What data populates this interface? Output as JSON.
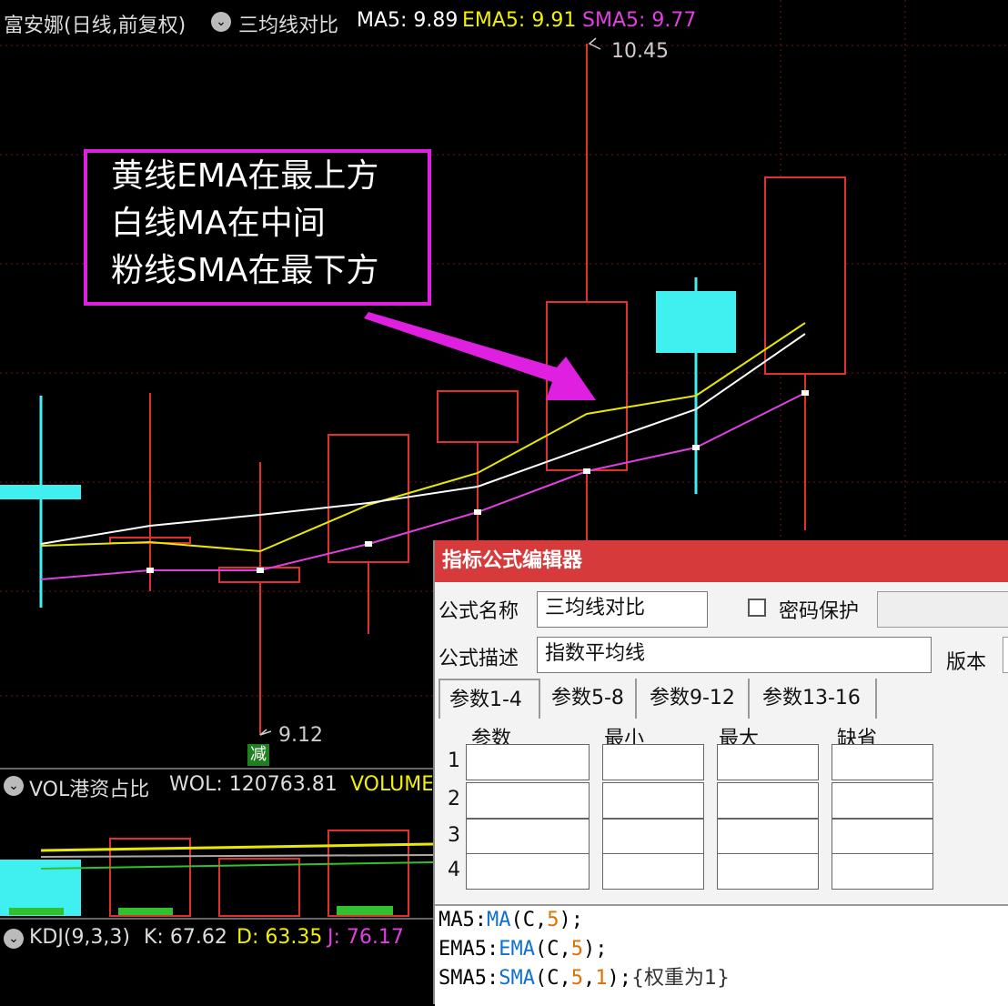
{
  "header": {
    "stock": "富安娜(日线,前复权)",
    "indicator": "三均线对比",
    "ma5": "MA5: 9.89",
    "ema5": "EMA5: 9.91",
    "sma5": "SMA5: 9.77",
    "colors": {
      "ma": "#ffffff",
      "ema": "#f0f000",
      "sma": "#e040e0"
    }
  },
  "price_labels": {
    "high": "10.45",
    "low": "9.12",
    "reduce_badge": "减"
  },
  "callout": {
    "line1": "黄线EMA在最上方",
    "line2": "白线MA在中间",
    "line3": "粉线SMA在最下方"
  },
  "vol_panel": {
    "label": "VOL港资占比",
    "wol": "WOL: 120763.81",
    "volume": "VOLUME"
  },
  "kdj_panel": {
    "label": "KDJ(9,3,3)",
    "k": "K: 67.62",
    "d": "D: 63.35",
    "j": "J: 76.17"
  },
  "editor": {
    "title": "指标公式编辑器",
    "name_label": "公式名称",
    "name_value": "三均线对比",
    "password_label": "密码保护",
    "desc_label": "公式描述",
    "desc_value": "指数平均线",
    "version_label": "版本",
    "tabs": [
      "参数1-4",
      "参数5-8",
      "参数9-12",
      "参数13-16"
    ],
    "columns": [
      "参数",
      "最小",
      "最大",
      "缺省"
    ],
    "rows": [
      "1",
      "2",
      "3",
      "4"
    ],
    "code": {
      "l1": {
        "name": "MA5",
        "fn": "MA",
        "arg": "C",
        "n": "5"
      },
      "l2": {
        "name": "EMA5",
        "fn": "EMA",
        "arg": "C",
        "n": "5"
      },
      "l3": {
        "name": "SMA5",
        "fn": "SMA",
        "arg": "C",
        "n": "5",
        "w": "1",
        "comment": "{权重为1}"
      }
    }
  }
}
